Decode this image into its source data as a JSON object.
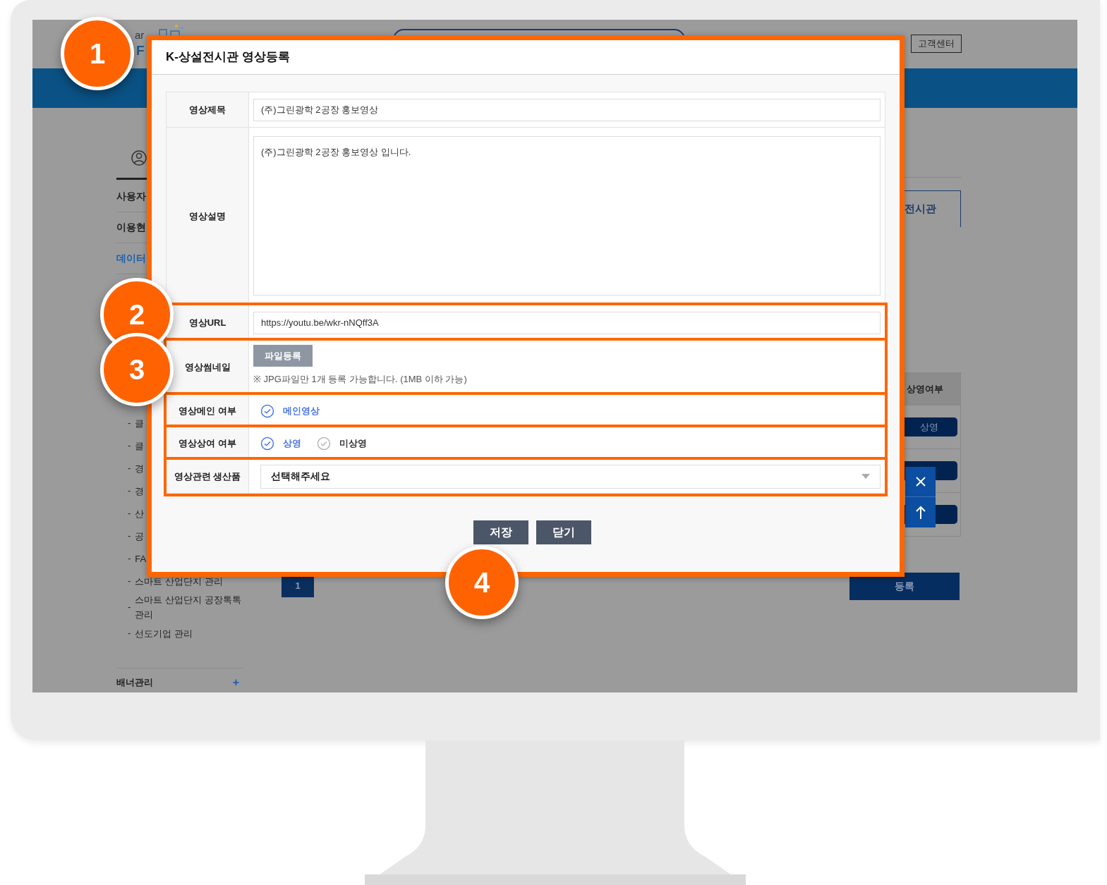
{
  "screen": {
    "header": {
      "logo_fragments": [
        "ar",
        "F"
      ],
      "buttons": [
        "고객센터"
      ]
    },
    "sidebar": {
      "menu": [
        {
          "label": "사용자",
          "selected": false
        },
        {
          "label": "이용현",
          "selected": false
        },
        {
          "label": "데이터",
          "selected": true
        }
      ],
      "bullet": "-",
      "submenu": [
        "클",
        "클",
        "경",
        "경",
        "산",
        "공",
        "FA",
        "스마트 산업단지 관리",
        "스마트 산업단지 공장톡톡 관리",
        "선도기업 관리"
      ],
      "footer": {
        "label": "배너관리",
        "icon_text": "+"
      }
    },
    "main": {
      "tab": "전시관",
      "table": {
        "column": "상영여부",
        "row_buttons": [
          "상영"
        ]
      },
      "pagination": [
        {
          "label": "1",
          "selected": true
        }
      ],
      "register_button": "등록"
    }
  },
  "modal": {
    "title": "K-상설전시관 영상등록",
    "highlighted": true,
    "fields": [
      {
        "kind": "text",
        "label": "영상제목",
        "value": "(주)그린광학 2공장 홍보영상",
        "highlighted": false
      },
      {
        "kind": "textarea",
        "label": "영상설명",
        "value": "(주)그린광학 2공장 홍보영상 입니다.",
        "highlighted": false
      },
      {
        "kind": "text",
        "label": "영상URL",
        "value": "https://youtu.be/wkr-nNQff3A",
        "highlighted": true
      },
      {
        "kind": "file",
        "label": "영상썸네일",
        "button": "파일등록",
        "note": "※ JPG파일만 1개 등록 가능합니다. (1MB 이하 가능)",
        "highlighted": true
      },
      {
        "kind": "radio",
        "label": "영상메인 여부",
        "options": [
          {
            "label": "메인영상",
            "selected": true
          }
        ],
        "highlighted": true
      },
      {
        "kind": "radio",
        "label": "영상상여 여부",
        "options": [
          {
            "label": "상영",
            "selected": true
          },
          {
            "label": "미상영",
            "selected": false
          }
        ],
        "highlighted": true
      },
      {
        "kind": "select",
        "label": "영상관련 생산품",
        "value": "선택해주세요",
        "highlighted": true
      }
    ],
    "buttons": [
      "저장",
      "닫기"
    ]
  },
  "annotations": [
    "1",
    "2",
    "3",
    "4"
  ]
}
